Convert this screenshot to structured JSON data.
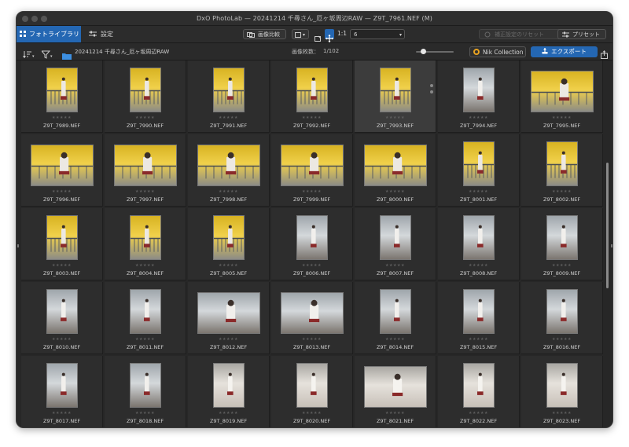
{
  "window": {
    "title": "DxO PhotoLab — 20241214 千尋さん_厄ヶ坂周辺RAW — Z9T_7961.NEF (M)"
  },
  "toolbar": {
    "tab_library": "フォトライブラリ",
    "tab_settings": "設定",
    "compare_label": "画像比較",
    "ratio_label": "1:1",
    "grid_count": "6",
    "reset_label": "補正設定のリセット",
    "preset_label": "プリセット"
  },
  "pathbar": {
    "folder": "20241214 千尋さん_厄ヶ坂周辺RAW",
    "count_label": "画像枚数：",
    "count_value": "1/102",
    "nik_label": "Nik Collection",
    "export_label": "エクスポート"
  },
  "colors": {
    "accent": "#2467b3",
    "window_bg": "#272727",
    "cell_bg": "#2d2d2d",
    "selected_cell_bg": "#3c3c3c",
    "nik": "#e8a321"
  },
  "icons": [
    "grid-icon",
    "sliders-icon",
    "compare-icon",
    "view-icon",
    "crop-icon",
    "move-icon",
    "reset-icon",
    "presets-icon",
    "sort-icon",
    "filter-icon",
    "folder-icon",
    "nik-logo-icon",
    "export-icon",
    "share-icon"
  ],
  "thumbnails": [
    {
      "name": "Z9T_7989.NEF",
      "orient": "portrait",
      "kind": "yellow"
    },
    {
      "name": "Z9T_7990.NEF",
      "orient": "portrait",
      "kind": "yellow"
    },
    {
      "name": "Z9T_7991.NEF",
      "orient": "portrait",
      "kind": "yellow"
    },
    {
      "name": "Z9T_7992.NEF",
      "orient": "portrait",
      "kind": "yellow"
    },
    {
      "name": "Z9T_7993.NEF",
      "orient": "portrait",
      "kind": "yellow",
      "selected": true
    },
    {
      "name": "Z9T_7994.NEF",
      "orient": "portrait",
      "kind": "street"
    },
    {
      "name": "Z9T_7995.NEF",
      "orient": "landscape",
      "kind": "yellow"
    },
    {
      "name": "Z9T_7996.NEF",
      "orient": "landscape",
      "kind": "yellow"
    },
    {
      "name": "Z9T_7997.NEF",
      "orient": "landscape",
      "kind": "yellow"
    },
    {
      "name": "Z9T_7998.NEF",
      "orient": "landscape",
      "kind": "yellow"
    },
    {
      "name": "Z9T_7999.NEF",
      "orient": "landscape",
      "kind": "yellow"
    },
    {
      "name": "Z9T_8000.NEF",
      "orient": "landscape",
      "kind": "yellow"
    },
    {
      "name": "Z9T_8001.NEF",
      "orient": "portrait",
      "kind": "yellow"
    },
    {
      "name": "Z9T_8002.NEF",
      "orient": "portrait",
      "kind": "yellow"
    },
    {
      "name": "Z9T_8003.NEF",
      "orient": "portrait",
      "kind": "yellow"
    },
    {
      "name": "Z9T_8004.NEF",
      "orient": "portrait",
      "kind": "yellow"
    },
    {
      "name": "Z9T_8005.NEF",
      "orient": "portrait",
      "kind": "yellow"
    },
    {
      "name": "Z9T_8006.NEF",
      "orient": "portrait",
      "kind": "street"
    },
    {
      "name": "Z9T_8007.NEF",
      "orient": "portrait",
      "kind": "street"
    },
    {
      "name": "Z9T_8008.NEF",
      "orient": "portrait",
      "kind": "street"
    },
    {
      "name": "Z9T_8009.NEF",
      "orient": "portrait",
      "kind": "street"
    },
    {
      "name": "Z9T_8010.NEF",
      "orient": "portrait",
      "kind": "street"
    },
    {
      "name": "Z9T_8011.NEF",
      "orient": "portrait",
      "kind": "street"
    },
    {
      "name": "Z9T_8012.NEF",
      "orient": "landscape",
      "kind": "street"
    },
    {
      "name": "Z9T_8013.NEF",
      "orient": "landscape",
      "kind": "street"
    },
    {
      "name": "Z9T_8014.NEF",
      "orient": "portrait",
      "kind": "street"
    },
    {
      "name": "Z9T_8015.NEF",
      "orient": "portrait",
      "kind": "street"
    },
    {
      "name": "Z9T_8016.NEF",
      "orient": "portrait",
      "kind": "street"
    },
    {
      "name": "Z9T_8017.NEF",
      "orient": "portrait",
      "kind": "street"
    },
    {
      "name": "Z9T_8018.NEF",
      "orient": "portrait",
      "kind": "street"
    },
    {
      "name": "Z9T_8019.NEF",
      "orient": "portrait",
      "kind": "portrait"
    },
    {
      "name": "Z9T_8020.NEF",
      "orient": "portrait",
      "kind": "portrait"
    },
    {
      "name": "Z9T_8021.NEF",
      "orient": "landscape",
      "kind": "portrait"
    },
    {
      "name": "Z9T_8022.NEF",
      "orient": "portrait",
      "kind": "portrait"
    },
    {
      "name": "Z9T_8023.NEF",
      "orient": "portrait",
      "kind": "portrait"
    }
  ]
}
